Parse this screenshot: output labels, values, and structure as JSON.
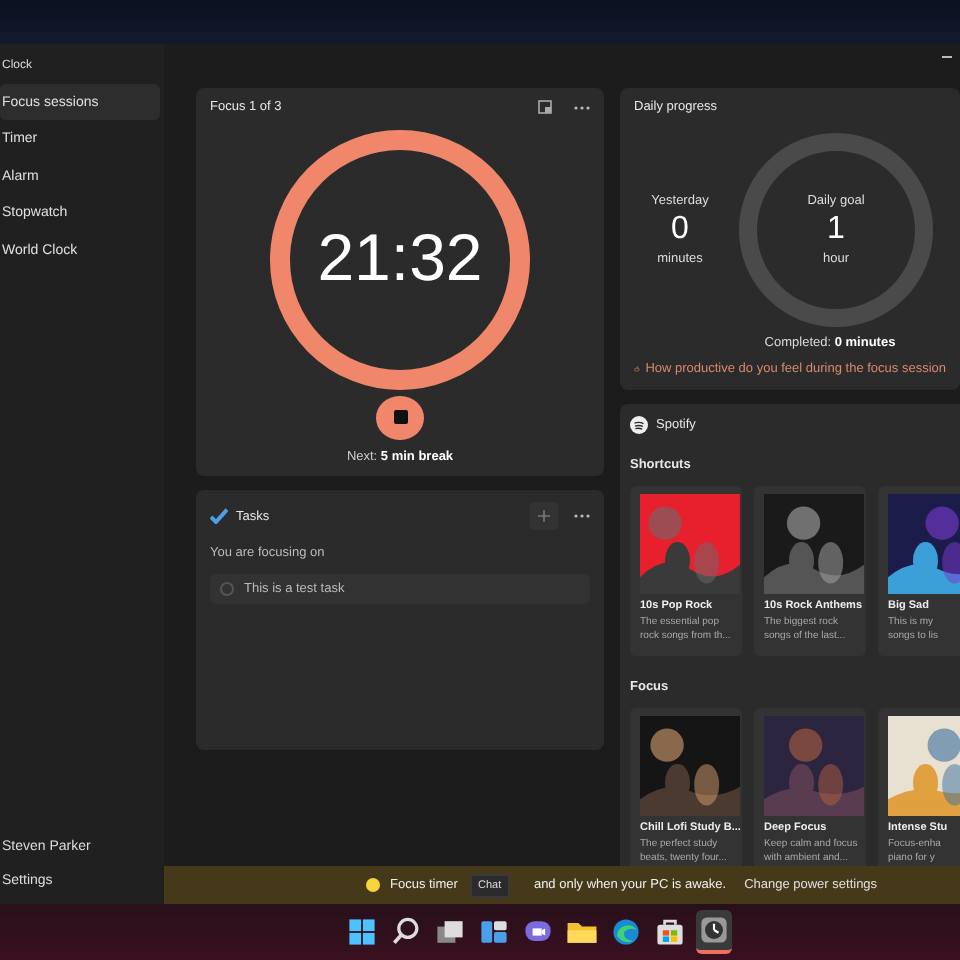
{
  "window": {
    "title": "Clock"
  },
  "sidebar": {
    "items": [
      {
        "label": "Focus sessions",
        "selected": true
      },
      {
        "label": "Timer",
        "selected": false
      },
      {
        "label": "Alarm",
        "selected": false
      },
      {
        "label": "Stopwatch",
        "selected": false
      },
      {
        "label": "World Clock",
        "selected": false
      }
    ],
    "user": "Steven Parker",
    "settings": "Settings"
  },
  "focus": {
    "title": "Focus 1 of 3",
    "time": "21:32",
    "level": 1,
    "next": "Next: **5 min break**"
  },
  "tasks": {
    "title": "Tasks",
    "subtitle": "You are focusing on",
    "items": [
      {
        "label": "This is a test task",
        "checked": false
      }
    ]
  },
  "daily_progress": {
    "title": "Daily progress",
    "yesterday_label": "Yesterday",
    "yesterday_value": "0",
    "yesterday_unit": "minutes",
    "goal_label": "Daily goal",
    "goal_value": "1",
    "goal_unit": "hour",
    "completed": "Completed: **0 minutes**",
    "feedback_link": "How productive do you feel during the focus session"
  },
  "spotify": {
    "title": "Spotify",
    "sections": [
      {
        "title": "Shortcuts",
        "items": [
          {
            "kind": "picture",
            "title": "10s Pop Rock",
            "lines": [
              "The essential pop",
              "rock songs from th..."
            ]
          },
          {
            "kind": "picture",
            "title": "10s Rock Anthems",
            "lines": [
              "The biggest rock",
              "songs of the last..."
            ]
          },
          {
            "kind": "picture",
            "title": "Big Sad",
            "lines": [
              "This is my",
              "songs to lis"
            ]
          }
        ]
      },
      {
        "title": "Focus",
        "items": [
          {
            "kind": "picture",
            "title": "Chill Lofi Study B...",
            "lines": [
              "The perfect study",
              "beats, twenty four..."
            ]
          },
          {
            "kind": "picture",
            "title": "Deep Focus",
            "lines": [
              "Keep calm and focus",
              "with ambient and..."
            ]
          },
          {
            "kind": "picture",
            "title": "Intense Stu",
            "lines": [
              "Focus-enha",
              "piano for y"
            ]
          }
        ]
      }
    ]
  },
  "banner": {
    "text_before": "Focus timer",
    "text_after": "and only when your PC is awake.",
    "link": "Change power settings"
  },
  "tooltip": "Chat",
  "taskbar": {
    "items": [
      {
        "kind": "start",
        "active": false
      },
      {
        "kind": "search",
        "active": false
      },
      {
        "kind": "taskview",
        "active": false
      },
      {
        "kind": "widgets",
        "active": false
      },
      {
        "kind": "chat",
        "active": false
      },
      {
        "kind": "explorer",
        "active": false
      },
      {
        "kind": "edge",
        "active": false
      },
      {
        "kind": "store",
        "active": false
      },
      {
        "kind": "clock",
        "active": true
      }
    ]
  }
}
